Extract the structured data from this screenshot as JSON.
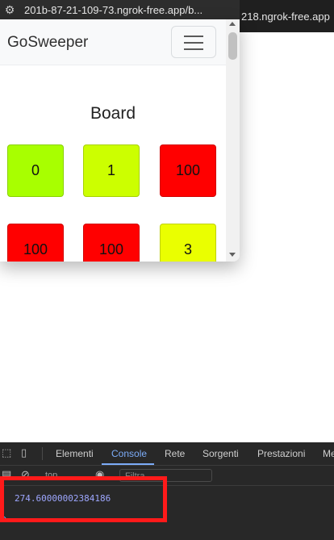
{
  "browser": {
    "left_tab_url": "201b-87-21-109-73.ngrok-free.app/b...",
    "right_tab_url": "218.ngrok-free.app"
  },
  "navbar": {
    "brand": "GoSweeper"
  },
  "board": {
    "title": "Board",
    "cells": [
      {
        "value": "0",
        "color": "#a8ff00"
      },
      {
        "value": "1",
        "color": "#ccff00"
      },
      {
        "value": "100",
        "color": "#ff0000"
      },
      {
        "value": "100",
        "color": "#ff0000"
      },
      {
        "value": "100",
        "color": "#ff0000"
      },
      {
        "value": "3",
        "color": "#eaff00"
      }
    ]
  },
  "devtools": {
    "tabs": [
      "Elementi",
      "Console",
      "Rete",
      "Sorgenti",
      "Prestazioni",
      "Me"
    ],
    "active_tab": "Console",
    "context": "top",
    "filter_placeholder": "Filtra",
    "output": "274.60000002384186",
    "prompt": "›"
  }
}
